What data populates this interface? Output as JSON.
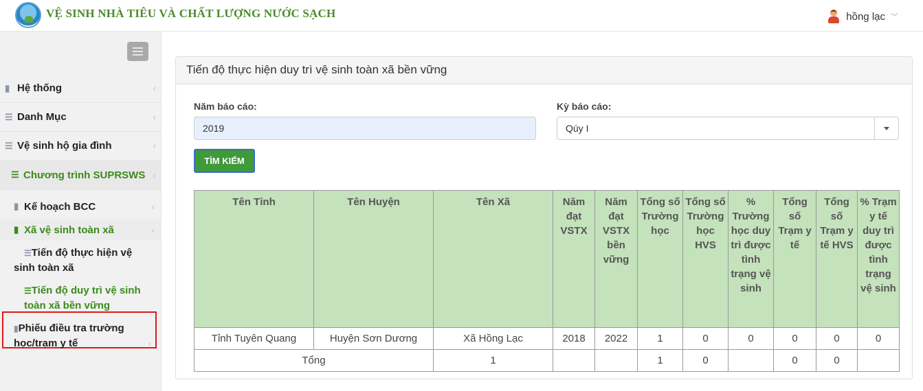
{
  "header": {
    "brand": "VỆ SINH NHÀ TIÊU VÀ CHẤT LƯỢNG NƯỚC SẠCH",
    "username": "hồng lạc",
    "user_chevron": "﹀"
  },
  "sidebar": {
    "items": [
      {
        "label": "Hệ thống",
        "icon": "file-icon",
        "arrow": "‹"
      },
      {
        "label": "Danh Mục",
        "icon": "list-icon",
        "arrow": "‹"
      },
      {
        "label": "Vệ sinh hộ gia đình",
        "icon": "server-icon",
        "arrow": "‹"
      },
      {
        "label": "Chương trình SUPRSWS",
        "icon": "server-icon",
        "arrow": "‹"
      }
    ],
    "sub_items": [
      {
        "label": "Kế hoạch BCC",
        "icon": "file-icon",
        "arrow": "‹"
      },
      {
        "label": "Xã vệ sinh toàn xã",
        "icon": "file-icon",
        "arrow": "‹"
      }
    ],
    "leaf_items": [
      {
        "line1": "Tiến độ thực hiện vệ",
        "line2": "sinh toàn xã"
      },
      {
        "line1": "Tiến độ duy trì vệ sinh",
        "line2": "toàn xã bền vững"
      }
    ],
    "survey_item": {
      "line1": "Phiếu điều tra trường",
      "line2": "học/trạm y tế",
      "arrow": "‹"
    }
  },
  "panel": {
    "title": "Tiến độ thực hiện duy trì vệ sinh toàn xã bền vững",
    "year_label": "Năm báo cáo:",
    "year_value": "2019",
    "period_label": "Kỳ báo cáo:",
    "period_value": "Qúy I",
    "search_button": "TÌM KIẾM"
  },
  "table": {
    "headers": [
      "Tên Tỉnh",
      "Tên Huyện",
      "Tên Xã",
      "Năm đạt VSTX",
      "Năm đạt VSTX bền vững",
      "Tổng số Trường học",
      "Tổng số Trường học HVS",
      "% Trường học duy trì được tình trạng vệ sinh",
      "Tổng số Trạm y tế",
      "Tổng số Trạm y tế HVS",
      "% Trạm y tế duy trì được tình trạng vệ sinh"
    ],
    "row": [
      "Tỉnh Tuyên Quang",
      "Huyện Sơn Dương",
      "Xã Hồng Lạc",
      "2018",
      "2022",
      "1",
      "0",
      "0",
      "0",
      "0",
      "0"
    ],
    "total": {
      "label": "Tổng",
      "xa_count": "1",
      "schools": "1",
      "schools_hvs": "0",
      "clinics": "0",
      "clinics_hvs": "0"
    }
  },
  "colors": {
    "brand_green": "#4c8a2b",
    "header_green": "#c4e2bc",
    "button_green": "#3e9a3a",
    "highlight_red": "#e01818"
  }
}
